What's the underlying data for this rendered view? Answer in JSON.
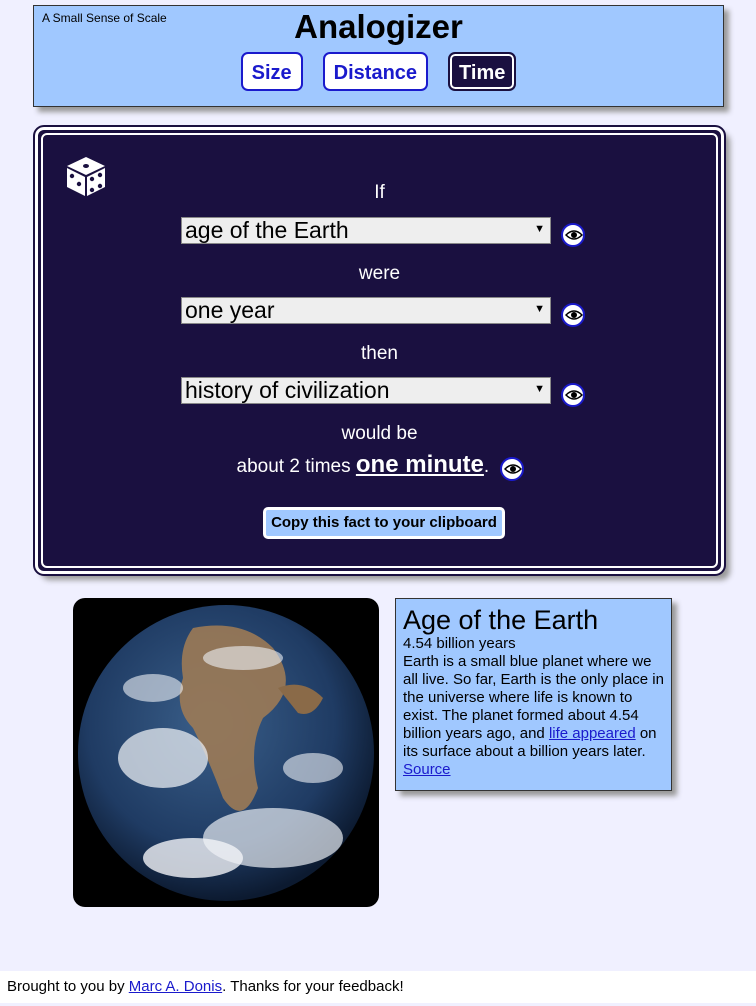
{
  "header": {
    "tagline": "A Small Sense of Scale",
    "title": "Analogizer",
    "tabs": [
      {
        "label": "Size",
        "active": false
      },
      {
        "label": "Distance",
        "active": false
      },
      {
        "label": "Time",
        "active": true
      }
    ]
  },
  "panel": {
    "label_if": "If",
    "select_1": "age of the Earth",
    "label_were": "were",
    "select_2": "one year",
    "label_then": "then",
    "select_3": "history of civilization",
    "label_would_be": "would be",
    "result_prefix": "about 2 times",
    "result_value": "one minute",
    "result_suffix": ".",
    "copy_button": "Copy this fact to your clipboard"
  },
  "info": {
    "title": "Age of the Earth",
    "value": "4.54 billion years",
    "text_1": "Earth is a small blue planet where we all live. So far, Earth is the only place in the universe where life is known to exist. The planet formed about 4.54 billion years ago, and",
    "link_text": "life appeared",
    "text_2": "on its surface about a billion years later.",
    "source_link": "Source"
  },
  "footer": {
    "prefix": "Brought to you by",
    "author_link": "Marc A. Donis",
    "suffix": ". Thanks for your feedback!"
  },
  "colors": {
    "accent": "#a0c8ff",
    "panel_bg": "#1a1040",
    "link": "#1a1acc",
    "page_bg": "#f0f0ff"
  }
}
